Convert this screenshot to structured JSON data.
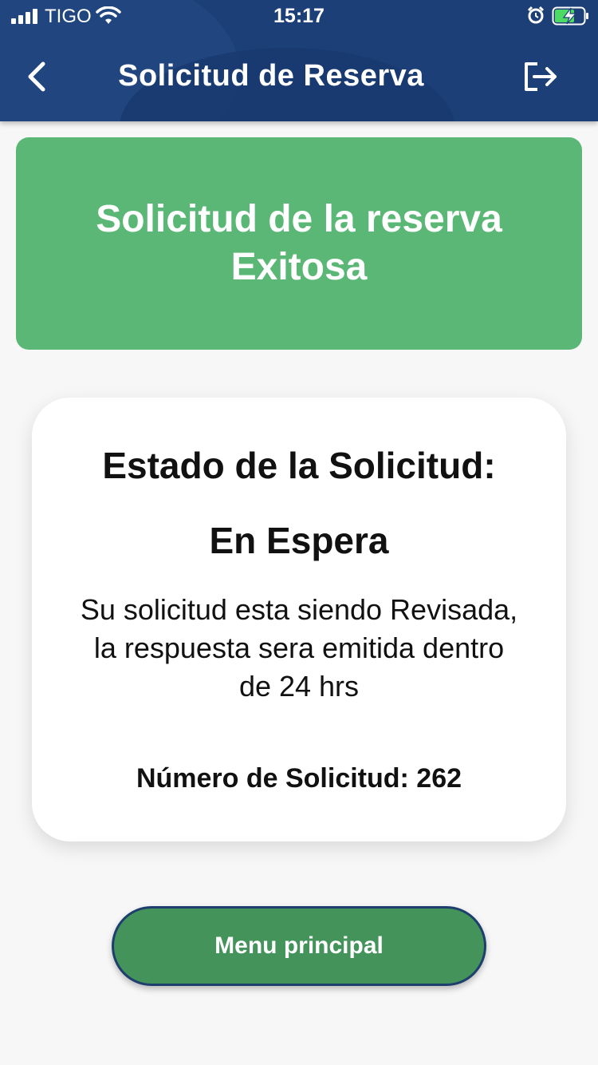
{
  "status_bar": {
    "carrier": "TIGO",
    "time": "15:17",
    "icons": [
      "signal-icon",
      "wifi-icon",
      "alarm-icon",
      "battery-charging-icon"
    ]
  },
  "nav": {
    "title": "Solicitud de Reserva",
    "back_icon": "back-chevron-icon",
    "logout_icon": "logout-icon"
  },
  "banner": {
    "line1": "Solicitud de la reserva",
    "line2": "Exitosa",
    "color": "#5bb776"
  },
  "card": {
    "title": "Estado de la Solicitud:",
    "status": "En Espera",
    "message": "Su solicitud esta siendo Revisada, la respuesta sera emitida dentro de 24 hrs",
    "number_label": "Número de Solicitud: 262"
  },
  "button": {
    "label": "Menu principal",
    "color": "#43935a"
  },
  "colors": {
    "header": "#1c3f78",
    "background": "#f7f7f7"
  }
}
